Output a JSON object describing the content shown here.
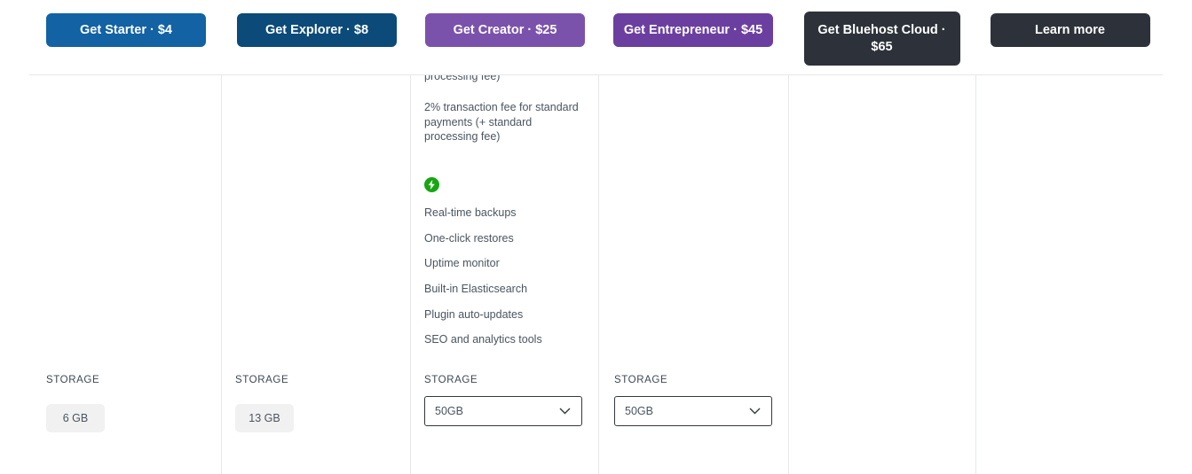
{
  "cta_bar": {
    "buttons": [
      {
        "label": "Get Starter · $4",
        "color": "#1262a4",
        "name": "get-starter-button"
      },
      {
        "label": "Get Explorer · $8",
        "color": "#0b4a79",
        "name": "get-explorer-button"
      },
      {
        "label": "Get Creator · $25",
        "color": "#7b52ab",
        "name": "get-creator-button"
      },
      {
        "label": "Get Entrepreneur · $45",
        "color": "#6b3fa0",
        "name": "get-entrepreneur-button"
      },
      {
        "label": "Get Bluehost Cloud · $65",
        "color": "#2d323a",
        "name": "get-bluehost-cloud-button"
      },
      {
        "label": "Learn more",
        "color": "#2d323a",
        "name": "learn-more-button"
      }
    ]
  },
  "columns": {
    "starter": {
      "storage_label": "STORAGE",
      "storage_value": "6 GB"
    },
    "explorer": {
      "storage_label": "STORAGE",
      "storage_value": "13 GB"
    },
    "creator": {
      "clipped_text": "processing fee)",
      "transaction_fee_text": "2% transaction fee for standard payments (+ standard processing fee)",
      "perk_icon": "lightning-bolt-icon",
      "features": [
        "Real-time backups",
        "One-click restores",
        "Uptime monitor",
        "Built-in Elasticsearch",
        "Plugin auto-updates",
        "SEO and analytics tools"
      ],
      "storage_label": "STORAGE",
      "storage_value": "50GB"
    },
    "entrepreneur": {
      "storage_label": "STORAGE",
      "storage_value": "50GB"
    }
  },
  "colors": {
    "divider": "#e6e7e8",
    "badge_bg": "#f1f1f1",
    "bolt_green": "#17a612",
    "text": "#4a5560"
  }
}
